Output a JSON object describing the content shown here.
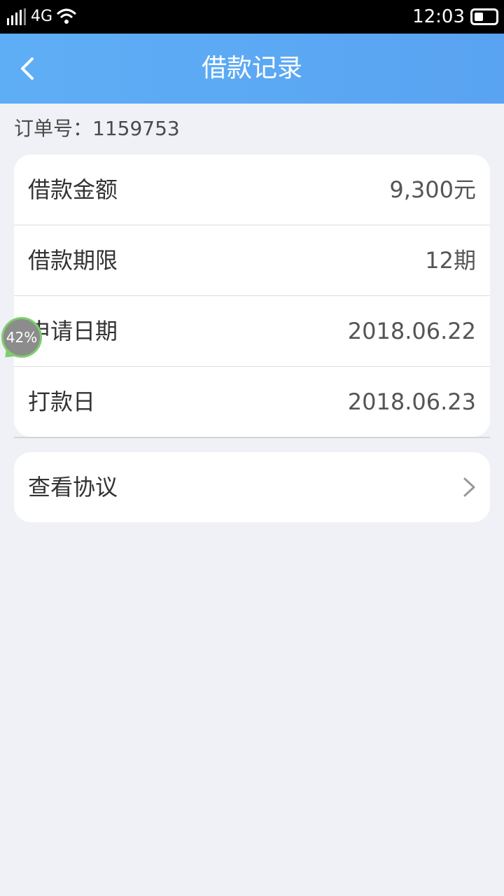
{
  "status_bar": {
    "network": "4G",
    "time": "12:03",
    "icons": [
      "signal-icon",
      "wifi-icon",
      "battery-icon"
    ]
  },
  "header": {
    "title": "借款记录",
    "back_icon": "chevron-left-icon"
  },
  "order": {
    "label": "订单号：1159753"
  },
  "details": [
    {
      "label": "借款金额",
      "value": "9,300元"
    },
    {
      "label": "借款期限",
      "value": "12期"
    },
    {
      "label": "申请日期",
      "value": "2018.06.22"
    },
    {
      "label": "打款日",
      "value": "2018.06.23"
    }
  ],
  "agreement": {
    "label": "查看协议",
    "icon": "chevron-right-icon"
  },
  "overlay": {
    "badge_text": "42%"
  },
  "colors": {
    "header_bg": "#5eaef5",
    "page_bg": "#eff1f6",
    "card_bg": "#ffffff"
  }
}
